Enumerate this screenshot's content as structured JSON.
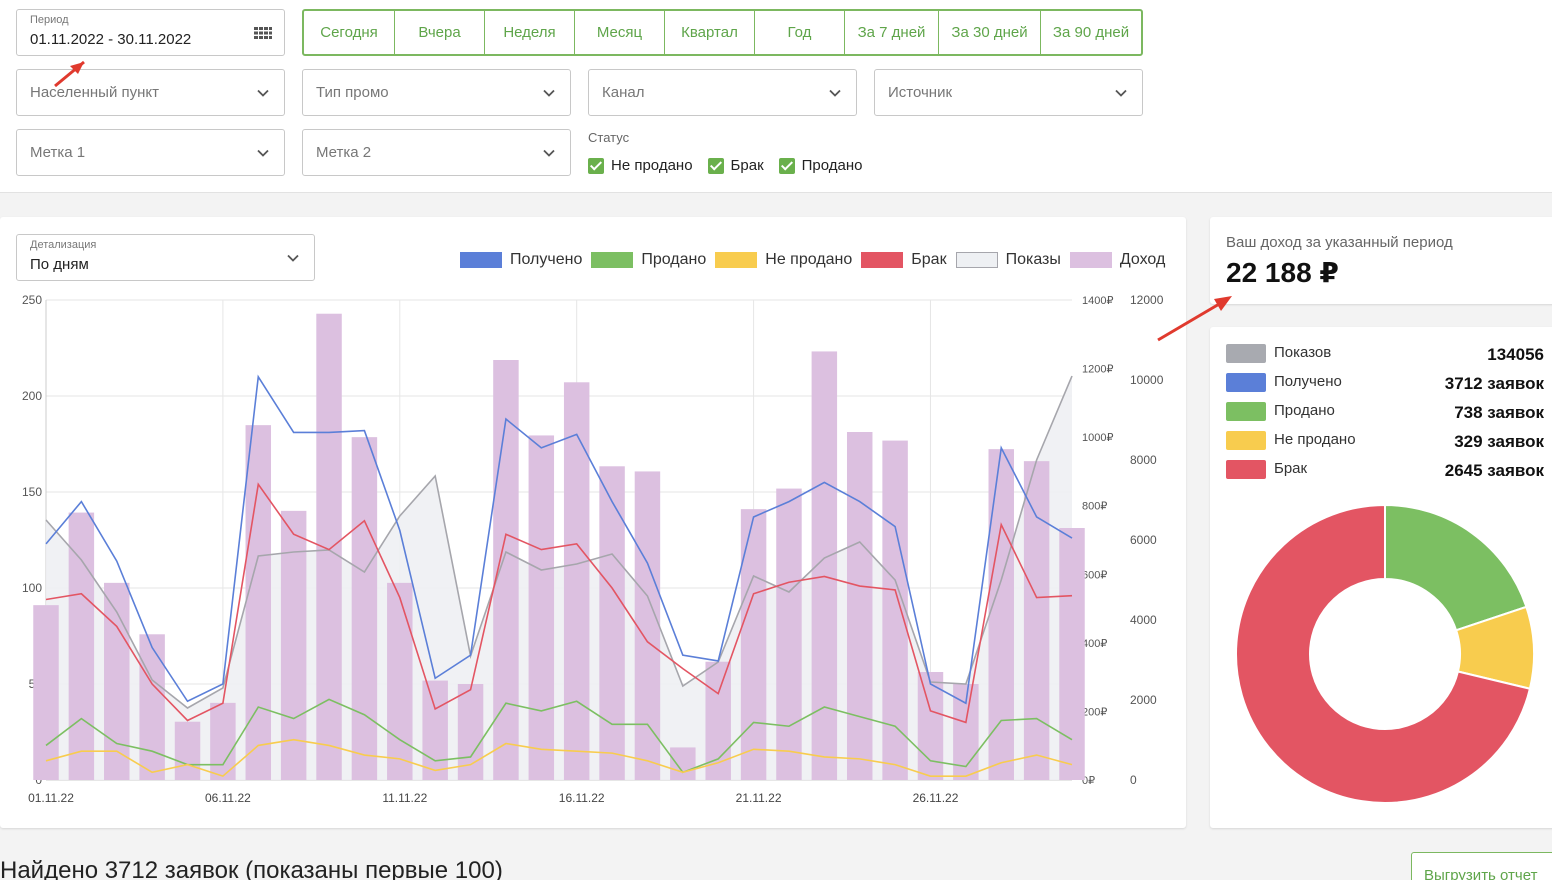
{
  "filters": {
    "period": {
      "label": "Период",
      "value": "01.11.2022 - 30.11.2022"
    },
    "period_buttons": [
      "Сегодня",
      "Вчера",
      "Неделя",
      "Месяц",
      "Квартал",
      "Год",
      "За 7 дней",
      "За 30 дней",
      "За 90 дней"
    ],
    "city": "Населенный пункт",
    "promo_type": "Тип промо",
    "channel": "Канал",
    "source": "Источник",
    "tag1": "Метка 1",
    "tag2": "Метка 2",
    "status": {
      "label": "Статус",
      "options": [
        "Не продано",
        "Брак",
        "Продано"
      ]
    }
  },
  "detail": {
    "label": "Детализация",
    "value": "По дням"
  },
  "legend": [
    {
      "name": "Получено",
      "color": "#5b7fd8"
    },
    {
      "name": "Продано",
      "color": "#7cbf62"
    },
    {
      "name": "Не продано",
      "color": "#f8cc4e"
    },
    {
      "name": "Брак",
      "color": "#e35563"
    },
    {
      "name": "Показы",
      "color": "#eef0f3"
    },
    {
      "name": "Доход",
      "color": "#dcc0e0"
    }
  ],
  "chart_data": {
    "type": "bar",
    "x_labels": [
      "01.11.22",
      "06.11.22",
      "11.11.22",
      "16.11.22",
      "21.11.22",
      "26.11.22"
    ],
    "x": [
      "01.11.22",
      "02.11.22",
      "03.11.22",
      "04.11.22",
      "05.11.22",
      "06.11.22",
      "07.11.22",
      "08.11.22",
      "09.11.22",
      "10.11.22",
      "11.11.22",
      "12.11.22",
      "13.11.22",
      "14.11.22",
      "15.11.22",
      "16.11.22",
      "17.11.22",
      "18.11.22",
      "19.11.22",
      "20.11.22",
      "21.11.22",
      "22.11.22",
      "23.11.22",
      "24.11.22",
      "25.11.22",
      "26.11.22",
      "27.11.22",
      "28.11.22",
      "29.11.22",
      "30.11.22"
    ],
    "y_left": {
      "ticks": [
        "0",
        "50",
        "100",
        "150",
        "200",
        "250"
      ],
      "range": [
        0,
        250
      ]
    },
    "y_money": {
      "ticks": [
        "0₽",
        "200₽",
        "400₽",
        "600₽",
        "800₽",
        "1000₽",
        "1200₽",
        "1400₽"
      ],
      "range": [
        0,
        1400
      ]
    },
    "y_views": {
      "ticks": [
        "0",
        "2000",
        "4000",
        "6000",
        "8000",
        "10000",
        "12000"
      ],
      "range": [
        0,
        12000
      ]
    },
    "series": [
      {
        "name": "Доход",
        "axis": "money",
        "color": "#dcc0e0",
        "values": [
          510,
          780,
          575,
          425,
          170,
          225,
          1035,
          785,
          1360,
          1000,
          575,
          290,
          280,
          1225,
          1005,
          1160,
          915,
          900,
          95,
          345,
          790,
          850,
          1250,
          1015,
          990,
          315,
          280,
          965,
          930,
          735
        ]
      },
      {
        "name": "Показы",
        "axis": "views",
        "color": "#a6a6ac",
        "values": [
          6500,
          5500,
          4200,
          2500,
          1800,
          2300,
          5600,
          5700,
          5750,
          5200,
          6600,
          7600,
          3100,
          5700,
          5250,
          5400,
          5650,
          4600,
          2350,
          2950,
          5100,
          4700,
          5550,
          5950,
          5000,
          2450,
          2400,
          5000,
          8000,
          10100
        ]
      },
      {
        "name": "Получено",
        "axis": "left",
        "color": "#5b7fd8",
        "values": [
          123,
          145,
          114,
          69,
          41,
          50,
          210,
          181,
          181,
          182,
          130,
          53,
          65,
          188,
          173,
          180,
          145,
          113,
          65,
          62,
          137,
          145,
          155,
          145,
          132,
          50,
          40,
          173,
          137,
          126
        ]
      },
      {
        "name": "Брак",
        "axis": "left",
        "color": "#e35563",
        "values": [
          94,
          97,
          80,
          50,
          31,
          40,
          154,
          128,
          120,
          135,
          95,
          37,
          47,
          128,
          120,
          123,
          100,
          72,
          58,
          45,
          97,
          103,
          106,
          101,
          99,
          36,
          30,
          133,
          95,
          96
        ]
      },
      {
        "name": "Продано",
        "axis": "left",
        "color": "#7cbf62",
        "values": [
          18,
          32,
          19,
          15,
          8,
          8,
          38,
          32,
          42,
          34,
          21,
          10,
          12,
          40,
          36,
          41,
          29,
          29,
          4,
          11,
          30,
          28,
          38,
          33,
          28,
          10,
          7,
          31,
          32,
          21
        ]
      },
      {
        "name": "Не продано",
        "axis": "left",
        "color": "#f8cc4e",
        "values": [
          10,
          15,
          15,
          4,
          8,
          2,
          18,
          21,
          18,
          13,
          11,
          5,
          8,
          19,
          16,
          15,
          14,
          10,
          4,
          9,
          16,
          15,
          12,
          11,
          8,
          2,
          2,
          9,
          13,
          8
        ]
      }
    ]
  },
  "income": {
    "label": "Ваш доход за указанный период",
    "value": "22 188 ₽"
  },
  "stats": [
    {
      "name": "Показов",
      "value": "134056",
      "color": "#a8aab0"
    },
    {
      "name": "Получено",
      "value": "3712 заявок",
      "color": "#5b7fd8"
    },
    {
      "name": "Продано",
      "value": "738 заявок",
      "color": "#7cbf62"
    },
    {
      "name": "Не продано",
      "value": "329 заявок",
      "color": "#f8cc4e"
    },
    {
      "name": "Брак",
      "value": "2645 заявок",
      "color": "#e35563"
    }
  ],
  "donut": {
    "segments": [
      {
        "name": "Продано",
        "value": 738,
        "color": "#7cbf62"
      },
      {
        "name": "Не продано",
        "value": 329,
        "color": "#f8cc4e"
      },
      {
        "name": "Брак",
        "value": 2645,
        "color": "#e35563"
      }
    ]
  },
  "found_text": "Найдено 3712 заявок (показаны первые 100)",
  "export_label": "Выгрузить отчет"
}
